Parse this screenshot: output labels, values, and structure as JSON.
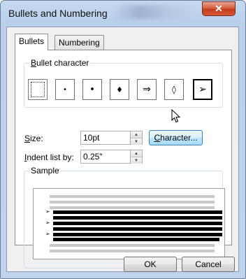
{
  "window": {
    "title": "Bullets and Numbering",
    "close_glyph": "✕"
  },
  "tabs": [
    {
      "label": "Bullets",
      "active": true
    },
    {
      "label": "Numbering",
      "active": false
    }
  ],
  "bullet_group": {
    "label_prefix": "B",
    "label_rest": "ullet character",
    "glyphs": [
      "",
      "•",
      "•",
      "♦",
      "⇒",
      "◊",
      "➢"
    ],
    "selected_index": 6
  },
  "size": {
    "label_prefix": "S",
    "label_rest": "ize:",
    "value": "10pt"
  },
  "indent": {
    "label_prefix": "I",
    "label_rest": "ndent list by:",
    "value": "0.25\""
  },
  "character_button": {
    "label_prefix": "C",
    "label_rest": "haracter..."
  },
  "sample": {
    "label": "Sample",
    "marker": "➢"
  },
  "buttons": {
    "ok": "OK",
    "cancel": "Cancel"
  },
  "colors": {
    "title_bar": "#b9cfea",
    "close_button": "#c53b1a",
    "dialog_bg": "#f0f0f0",
    "focus_button": "#bee6fd"
  }
}
